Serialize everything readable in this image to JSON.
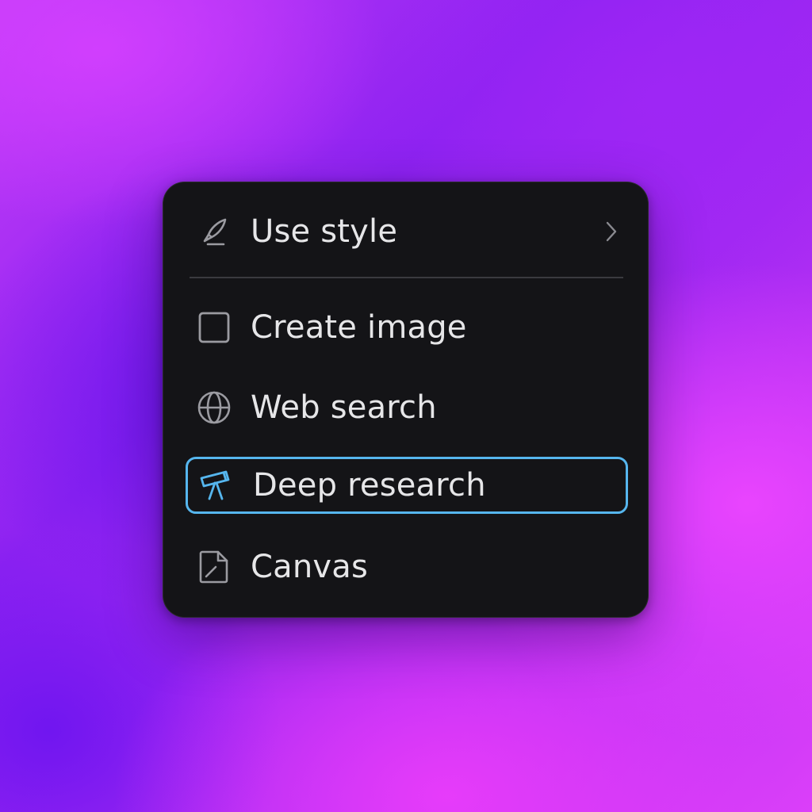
{
  "menu": {
    "items": [
      {
        "label": "Use style",
        "icon": "brush-icon",
        "has_submenu": true
      },
      {
        "label": "Create image",
        "icon": "square-icon"
      },
      {
        "label": "Web search",
        "icon": "globe-icon"
      },
      {
        "label": "Deep research",
        "icon": "telescope-icon",
        "selected": true
      },
      {
        "label": "Canvas",
        "icon": "document-icon"
      }
    ]
  },
  "colors": {
    "panel": "#141417",
    "text": "#e6e6e8",
    "icon": "#9b9ba1",
    "accent": "#56b6ee",
    "divider": "#3a3a3f"
  }
}
